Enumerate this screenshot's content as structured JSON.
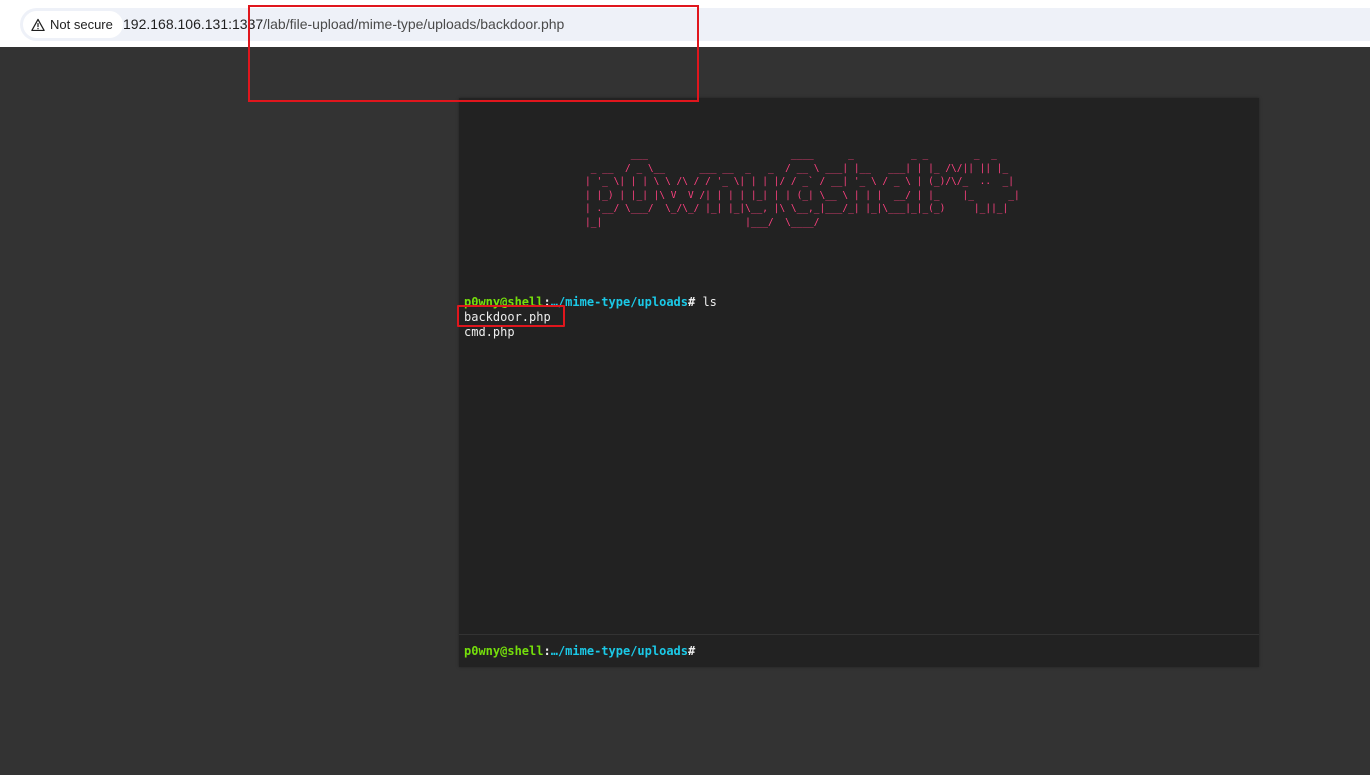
{
  "browser": {
    "security_label": "Not secure",
    "security_icon": "warning-triangle-icon",
    "url_host": "192.168.106.131:1337",
    "url_path": "/lab/file-upload/mime-type/uploads/backdoor.php"
  },
  "shell": {
    "banner": "        ___                         ____      _          _ _        _  _   \n _ __  / _ \\__      ___ __  _   _  / __ \\ ___| |__   ___| | |_ /\\/|| || |_ \n| '_ \\| | | \\ \\ /\\ / / '_ \\| | | |/ / _` / __| '_ \\ / _ \\ | (_)/\\/_  ..  _|\n| |_) | |_| |\\ V  V /| | | | |_| | | (_| \\__ \\ | | |  __/ | |_    |_      _|\n| .__/ \\___/  \\_/\\_/ |_| |_|\\__, |\\ \\__,_|___/_| |_|\\___|_|_(_)     |_||_|  \n|_|                         |___/  \\____/                                  ",
    "history": {
      "prompt_user": "p0wny@shell",
      "prompt_sep": ":",
      "prompt_path": "…/mime-type/uploads",
      "prompt_end": "# ",
      "command": "ls",
      "output": [
        "backdoor.php",
        "cmd.php"
      ]
    },
    "input_prompt": {
      "user": "p0wny@shell",
      "sep": ":",
      "path": "…/mime-type/uploads",
      "end": "#"
    },
    "input_value": ""
  },
  "colors": {
    "banner": "#ff4180",
    "prompt_user": "#75df0b",
    "prompt_path": "#1bc9e7",
    "annotation": "#e0161d"
  }
}
